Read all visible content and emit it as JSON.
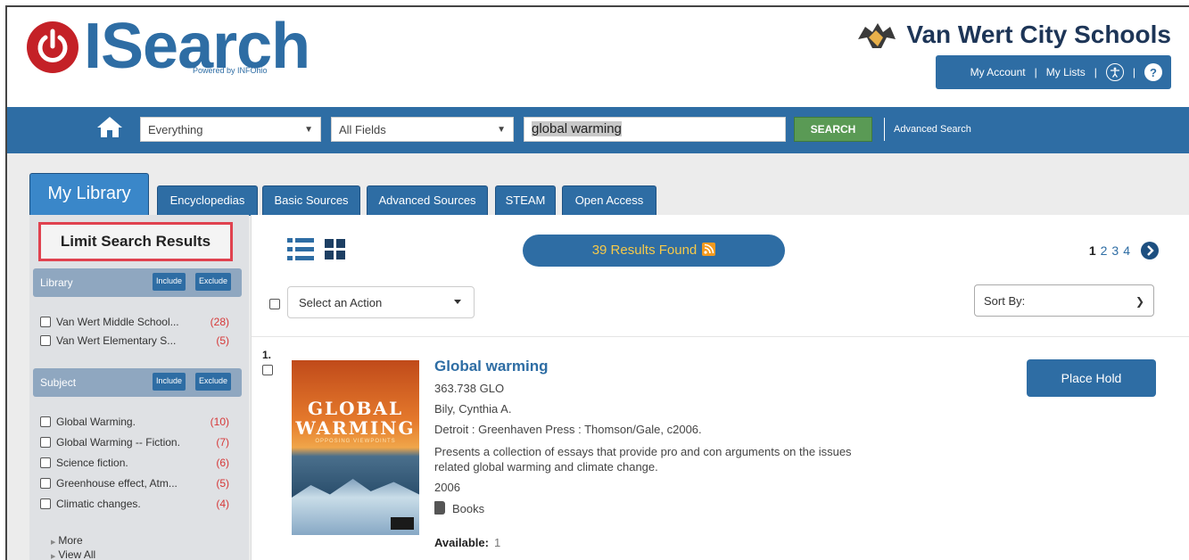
{
  "header": {
    "logo_text": "ISearch",
    "logo_sub": "Powered by INFOhio",
    "school_name": "Van Wert City Schools",
    "account": {
      "my_account": "My Account",
      "sep1": "|",
      "my_lists": "My Lists",
      "sep2": "|",
      "sep3": "|",
      "help_glyph": "?"
    }
  },
  "search": {
    "scope_value": "Everything",
    "field_value": "All Fields",
    "query_value": "global warming",
    "search_label": "SEARCH",
    "advanced_label": "Advanced Search"
  },
  "tabs": [
    {
      "label": "My Library"
    },
    {
      "label": "Encyclopedias"
    },
    {
      "label": "Basic Sources"
    },
    {
      "label": "Advanced Sources"
    },
    {
      "label": "STEAM"
    },
    {
      "label": "Open Access"
    }
  ],
  "sidebar": {
    "limit_title": "Limit Search Results",
    "include_label": "Include",
    "exclude_label": "Exclude",
    "library": {
      "title": "Library",
      "items": [
        {
          "label": "Van Wert Middle School...",
          "count": "(28)"
        },
        {
          "label": "Van Wert Elementary S...",
          "count": "(5)"
        }
      ]
    },
    "subject": {
      "title": "Subject",
      "items": [
        {
          "label": "Global Warming.",
          "count": "(10)"
        },
        {
          "label": "Global Warming -- Fiction.",
          "count": "(7)"
        },
        {
          "label": "Science fiction.",
          "count": "(6)"
        },
        {
          "label": "Greenhouse effect, Atm...",
          "count": "(5)"
        },
        {
          "label": "Climatic changes.",
          "count": "(4)"
        }
      ]
    },
    "more_label": "More",
    "view_all_label": "View All"
  },
  "results": {
    "count_label": "39 Results Found",
    "pages": [
      "1",
      "2",
      "3",
      "4"
    ],
    "action_placeholder": "Select an Action",
    "sort_label": "Sort By:",
    "record": {
      "number": "1.",
      "title": "Global warming",
      "call_number": "363.738 GLO",
      "author": "Bily, Cynthia A.",
      "publisher": "Detroit : Greenhaven Press : Thomson/Gale, c2006.",
      "description": "Presents a collection of essays that provide pro and con arguments on the issues related global warming and climate change.",
      "year": "2006",
      "format": "Books",
      "available_label": "Available:",
      "available_value": "1",
      "hold_label": "Place Hold",
      "cover_line1": "GLOBAL",
      "cover_line2": "WARMING",
      "cover_line3": "OPPOSING VIEWPOINTS"
    }
  },
  "colors": {
    "brand_blue": "#2e6da4",
    "search_green": "#5a9a55",
    "count_red": "#d63838",
    "highlight_red": "#e0424f"
  }
}
